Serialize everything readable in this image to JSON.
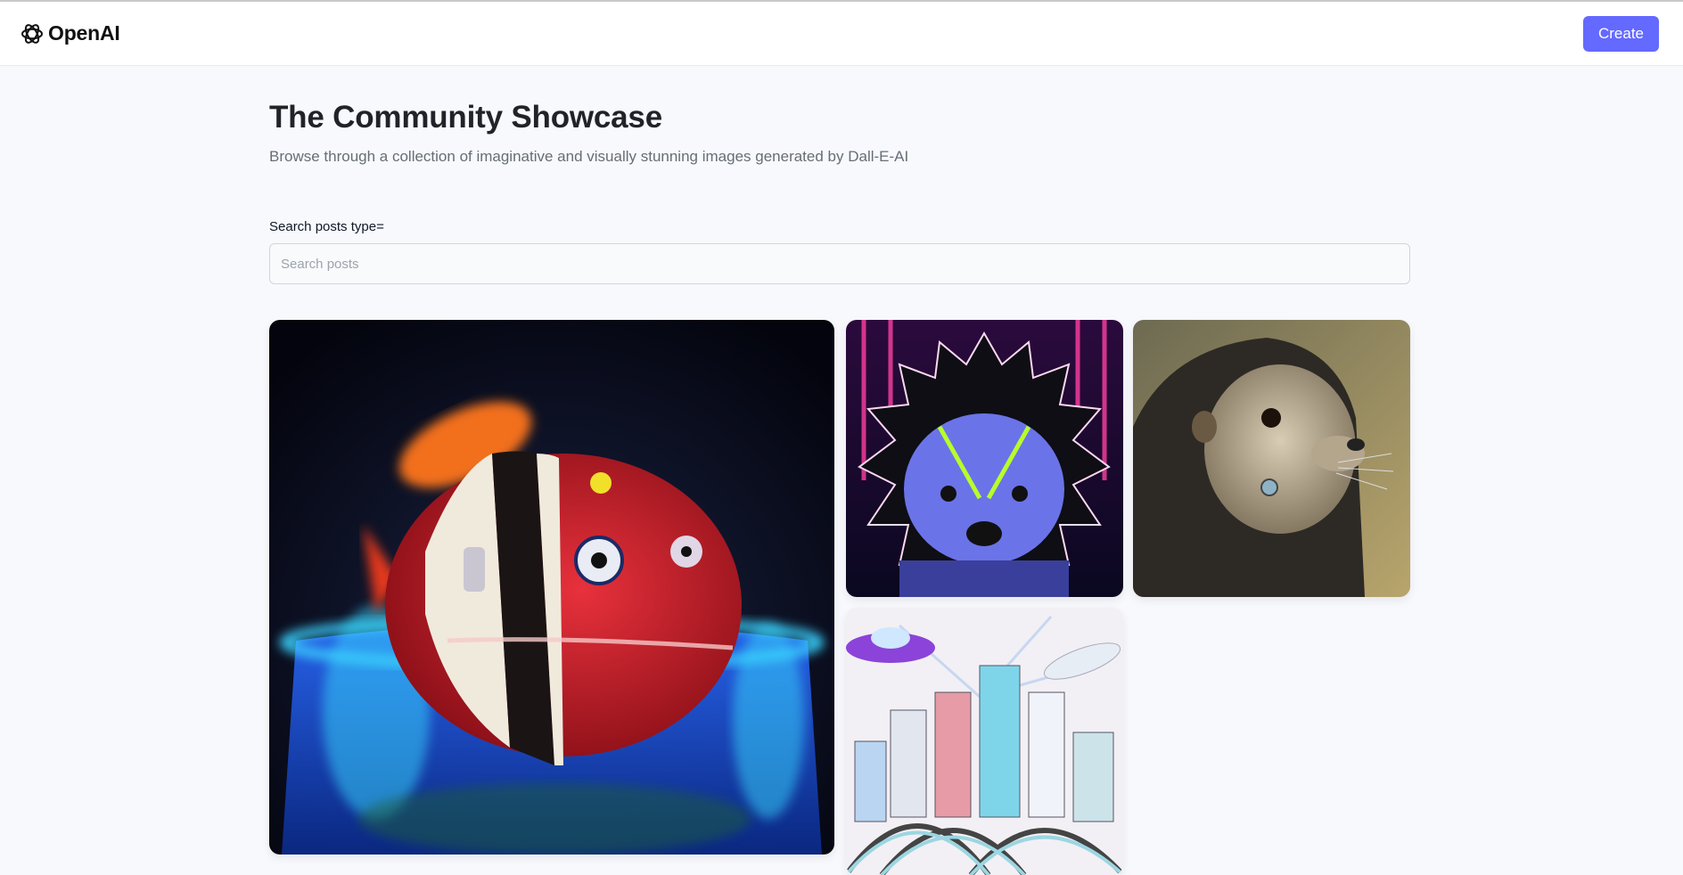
{
  "header": {
    "logo_text": "OpenAI",
    "create_label": "Create",
    "accent": "#6469ff"
  },
  "hero": {
    "title": "The Community Showcase",
    "subtitle": "Browse through a collection of imaginative and visually stunning images generated by Dall-E-AI"
  },
  "search": {
    "label": "Search posts type=",
    "placeholder": "Search posts",
    "value": ""
  },
  "posts": [
    {
      "subject": "clownfish in a fishbowl"
    },
    {
      "subject": "neon cyberpunk hedgehog"
    },
    {
      "subject": "hooded otter painting"
    },
    {
      "subject": "colored pencil city with flying saucer"
    }
  ]
}
